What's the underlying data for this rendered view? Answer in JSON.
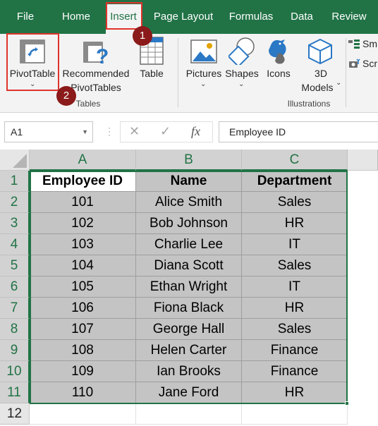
{
  "tabs": [
    {
      "label": "File",
      "active": false
    },
    {
      "label": "Home",
      "active": false
    },
    {
      "label": "Insert",
      "active": true
    },
    {
      "label": "Page Layout",
      "active": false
    },
    {
      "label": "Formulas",
      "active": false
    },
    {
      "label": "Data",
      "active": false
    },
    {
      "label": "Review",
      "active": false
    }
  ],
  "ribbon": {
    "pivottable": {
      "label": "PivotTable",
      "icon": "pivottable-icon"
    },
    "recommended": {
      "line1": "Recommended",
      "line2": "PivotTables",
      "icon": "recommended-pivottables-icon"
    },
    "table": {
      "label": "Table",
      "icon": "table-icon"
    },
    "tables_group": "Tables",
    "pictures": {
      "label": "Pictures",
      "icon": "pictures-icon"
    },
    "shapes": {
      "label": "Shapes",
      "icon": "shapes-icon"
    },
    "icons": {
      "label": "Icons",
      "icon": "icons-icon"
    },
    "models": {
      "line1": "3D",
      "line2": "Models",
      "icon": "3d-models-icon"
    },
    "smartart": {
      "label": "Sm",
      "icon": "smartart-icon"
    },
    "screenshot": {
      "label": "Scr",
      "icon": "screenshot-icon"
    },
    "illustrations_group": "Illustrations"
  },
  "formula_bar": {
    "name_box": "A1",
    "fx": "fx",
    "value": "Employee ID"
  },
  "columns": [
    "A",
    "B",
    "C"
  ],
  "rows": [
    "1",
    "2",
    "3",
    "4",
    "5",
    "6",
    "7",
    "8",
    "9",
    "10",
    "11",
    "12"
  ],
  "table": {
    "headers": [
      "Employee ID",
      "Name",
      "Department"
    ],
    "data": [
      [
        "101",
        "Alice Smith",
        "Sales"
      ],
      [
        "102",
        "Bob Johnson",
        "HR"
      ],
      [
        "103",
        "Charlie Lee",
        "IT"
      ],
      [
        "104",
        "Diana Scott",
        "Sales"
      ],
      [
        "105",
        "Ethan Wright",
        "IT"
      ],
      [
        "106",
        "Fiona Black",
        "HR"
      ],
      [
        "107",
        "George Hall",
        "Sales"
      ],
      [
        "108",
        "Helen Carter",
        "Finance"
      ],
      [
        "109",
        "Ian Brooks",
        "Finance"
      ],
      [
        "110",
        "Jane Ford",
        "HR"
      ]
    ]
  },
  "callouts": [
    "1",
    "2"
  ],
  "colors": {
    "excel_green": "#217346",
    "highlight_red": "#e0332b",
    "badge": "#8b1a1a"
  }
}
